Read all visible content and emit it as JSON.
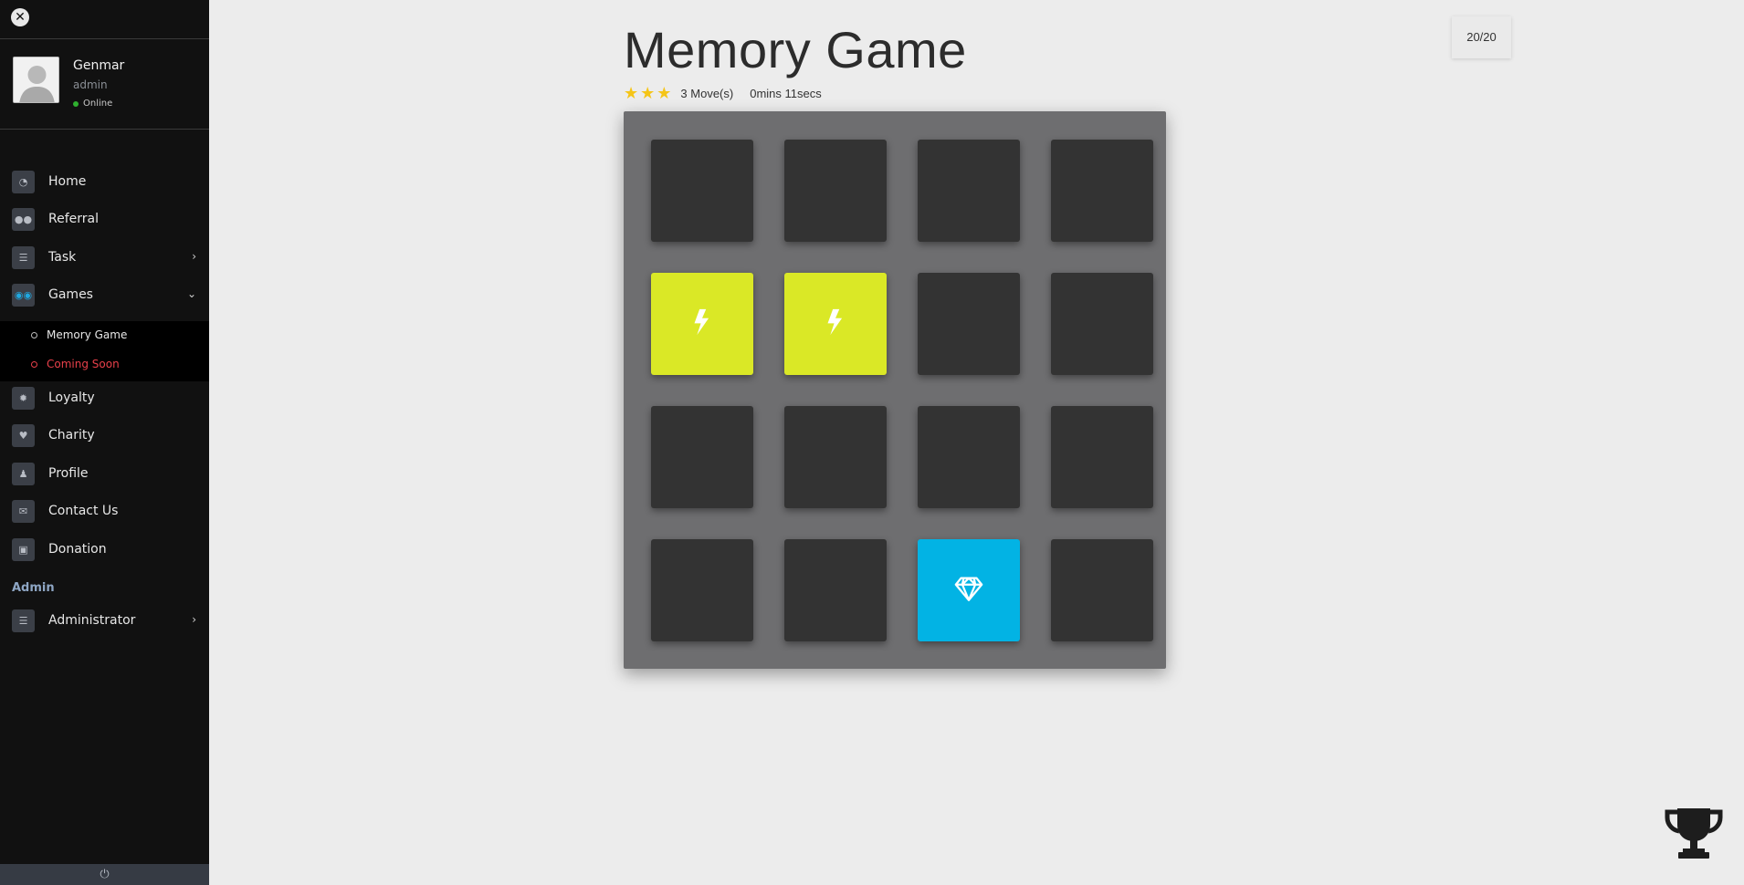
{
  "sidebar": {
    "user": {
      "name": "Genmar",
      "role": "admin",
      "status": "Online"
    },
    "nav": [
      {
        "label": "Home",
        "icon": "dashboard-icon"
      },
      {
        "label": "Referral",
        "icon": "users-icon"
      },
      {
        "label": "Task",
        "icon": "list-icon",
        "chevron": "›"
      },
      {
        "label": "Games",
        "icon": "gamepad-icon",
        "chevron": "⌄"
      }
    ],
    "games_submenu": [
      {
        "label": "Memory Game",
        "color": "#e8e8e8"
      },
      {
        "label": "Coming Soon",
        "color": "#e8404a"
      }
    ],
    "nav2": [
      {
        "label": "Loyalty",
        "icon": "badge-icon"
      },
      {
        "label": "Charity",
        "icon": "handshake-icon"
      },
      {
        "label": "Profile",
        "icon": "user-icon"
      },
      {
        "label": "Contact Us",
        "icon": "envelope-icon"
      },
      {
        "label": "Donation",
        "icon": "gift-icon"
      }
    ],
    "admin_header": "Admin",
    "admin_item": {
      "label": "Administrator",
      "icon": "list-icon",
      "chevron": "›"
    }
  },
  "game": {
    "title": "Memory Game",
    "stars": 3,
    "moves": "3 Move(s)",
    "timer": "0mins 11secs",
    "counter": "20/20",
    "cards": [
      "closed",
      "closed",
      "closed",
      "closed",
      "match-bolt",
      "match-bolt",
      "closed",
      "closed",
      "closed",
      "closed",
      "closed",
      "closed",
      "closed",
      "closed",
      "open-diamond",
      "closed"
    ]
  },
  "colors": {
    "sidebar_bg": "#111111",
    "match": "#dae826",
    "open": "#02b3e4",
    "card_closed": "#333333",
    "deck": "#6e6e70",
    "accent_red": "#e8404a"
  }
}
